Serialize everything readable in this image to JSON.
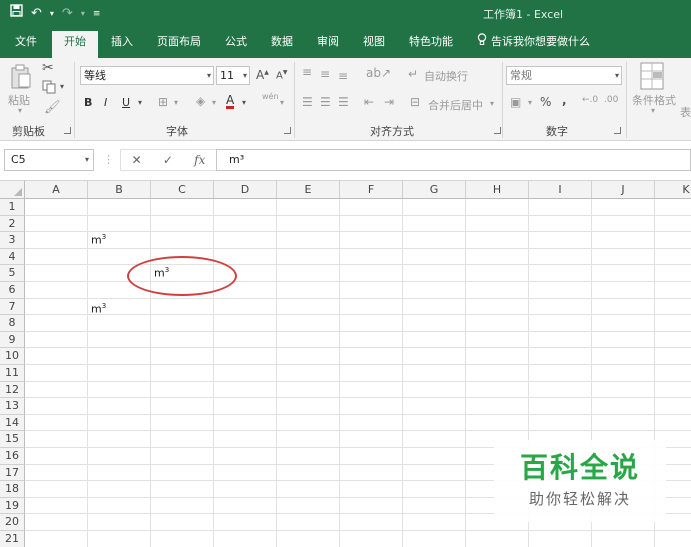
{
  "app": {
    "title": "工作簿1  -  Excel",
    "accent": "#217346"
  },
  "qat": {
    "save_icon": "save-icon",
    "undo_icon": "undo-icon",
    "redo_icon": "redo-icon",
    "customize_icon": "customize-qat-icon"
  },
  "tabs": [
    {
      "label": "文件"
    },
    {
      "label": "开始"
    },
    {
      "label": "插入"
    },
    {
      "label": "页面布局"
    },
    {
      "label": "公式"
    },
    {
      "label": "数据"
    },
    {
      "label": "审阅"
    },
    {
      "label": "视图"
    },
    {
      "label": "特色功能"
    }
  ],
  "active_tab": "开始",
  "tellme": {
    "label": "告诉我你想要做什么",
    "icon": "lightbulb-icon"
  },
  "ribbon": {
    "clipboard": {
      "label": "剪贴板",
      "paste_label": "粘贴"
    },
    "font": {
      "label": "字体",
      "font_name": "等线",
      "font_size": "11",
      "bold": "B",
      "italic": "I",
      "underline": "U",
      "font_color_letter": "A",
      "wen": "wén"
    },
    "alignment": {
      "label": "对齐方式",
      "wrap_text": "自动换行",
      "merge_center": "合并后居中"
    },
    "number": {
      "label": "数字",
      "format": "常规",
      "percent": "%",
      "comma": ","
    },
    "styles": {
      "conditional_format": "条件格式",
      "table_partial": "表"
    }
  },
  "formula_bar": {
    "name_box": "C5",
    "cancel": "✕",
    "enter": "✓",
    "fx": "fx",
    "formula": "m³"
  },
  "sheet": {
    "columns": [
      "A",
      "B",
      "C",
      "D",
      "E",
      "F",
      "G",
      "H",
      "I",
      "J",
      "K"
    ],
    "rows": [
      "1",
      "2",
      "3",
      "4",
      "5",
      "6",
      "7",
      "8",
      "9",
      "10",
      "11",
      "12",
      "13",
      "14",
      "15",
      "16",
      "17",
      "18",
      "19",
      "20",
      "21"
    ],
    "cells": {
      "B3": {
        "base": "m",
        "sup": "3"
      },
      "C5": {
        "base": "m",
        "sup": "3"
      },
      "B7": {
        "base": "m",
        "sup": "3"
      }
    },
    "annotation_color": "#d04040"
  },
  "watermark": {
    "title": "百科全说",
    "subtitle": "助你轻松解决",
    "color": "#27a745"
  }
}
